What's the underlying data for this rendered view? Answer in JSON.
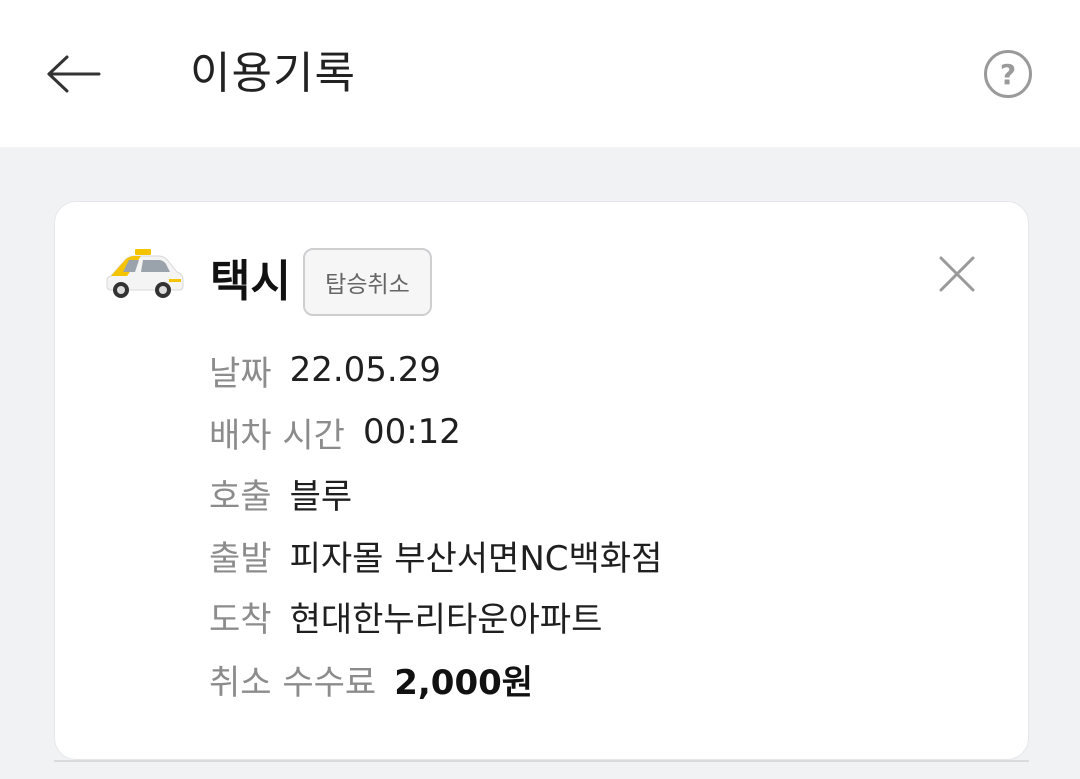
{
  "header": {
    "title": "이용기록",
    "back_icon": "arrow-left-icon",
    "help_label": "?",
    "help_icon": "question-circle-icon"
  },
  "record": {
    "icon": "taxi-icon",
    "service": "택시",
    "status": "탑승취소",
    "close_icon": "close-icon",
    "rows": [
      {
        "label": "날짜",
        "value": "22.05.29"
      },
      {
        "label": "배차 시간",
        "value": "00:12"
      },
      {
        "label": "호출",
        "value": "블루"
      },
      {
        "label": "출발",
        "value": "피자몰 부산서면NC백화점"
      },
      {
        "label": "도착",
        "value": "현대한누리타운아파트"
      },
      {
        "label": "취소 수수료",
        "value": "2,000원"
      }
    ]
  },
  "colors": {
    "background": "#f1f2f4",
    "card": "#ffffff",
    "label_gray": "#8c8c8c",
    "taxi_yellow": "#f5c400"
  }
}
